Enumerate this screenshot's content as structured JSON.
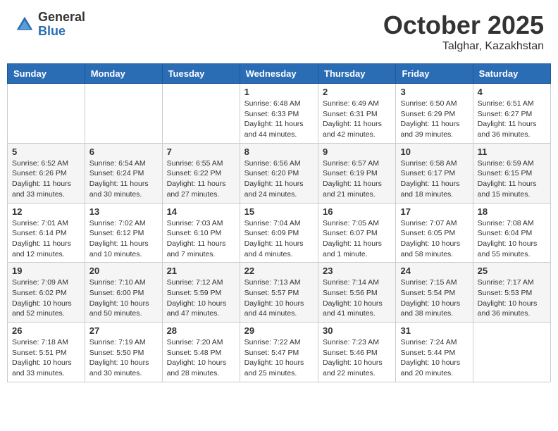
{
  "header": {
    "logo_general": "General",
    "logo_blue": "Blue",
    "month": "October 2025",
    "location": "Talghar, Kazakhstan"
  },
  "weekdays": [
    "Sunday",
    "Monday",
    "Tuesday",
    "Wednesday",
    "Thursday",
    "Friday",
    "Saturday"
  ],
  "weeks": [
    [
      {
        "day": null
      },
      {
        "day": null
      },
      {
        "day": null
      },
      {
        "day": "1",
        "sunrise": "6:48 AM",
        "sunset": "6:33 PM",
        "daylight": "11 hours and 44 minutes."
      },
      {
        "day": "2",
        "sunrise": "6:49 AM",
        "sunset": "6:31 PM",
        "daylight": "11 hours and 42 minutes."
      },
      {
        "day": "3",
        "sunrise": "6:50 AM",
        "sunset": "6:29 PM",
        "daylight": "11 hours and 39 minutes."
      },
      {
        "day": "4",
        "sunrise": "6:51 AM",
        "sunset": "6:27 PM",
        "daylight": "11 hours and 36 minutes."
      }
    ],
    [
      {
        "day": "5",
        "sunrise": "6:52 AM",
        "sunset": "6:26 PM",
        "daylight": "11 hours and 33 minutes."
      },
      {
        "day": "6",
        "sunrise": "6:54 AM",
        "sunset": "6:24 PM",
        "daylight": "11 hours and 30 minutes."
      },
      {
        "day": "7",
        "sunrise": "6:55 AM",
        "sunset": "6:22 PM",
        "daylight": "11 hours and 27 minutes."
      },
      {
        "day": "8",
        "sunrise": "6:56 AM",
        "sunset": "6:20 PM",
        "daylight": "11 hours and 24 minutes."
      },
      {
        "day": "9",
        "sunrise": "6:57 AM",
        "sunset": "6:19 PM",
        "daylight": "11 hours and 21 minutes."
      },
      {
        "day": "10",
        "sunrise": "6:58 AM",
        "sunset": "6:17 PM",
        "daylight": "11 hours and 18 minutes."
      },
      {
        "day": "11",
        "sunrise": "6:59 AM",
        "sunset": "6:15 PM",
        "daylight": "11 hours and 15 minutes."
      }
    ],
    [
      {
        "day": "12",
        "sunrise": "7:01 AM",
        "sunset": "6:14 PM",
        "daylight": "11 hours and 12 minutes."
      },
      {
        "day": "13",
        "sunrise": "7:02 AM",
        "sunset": "6:12 PM",
        "daylight": "11 hours and 10 minutes."
      },
      {
        "day": "14",
        "sunrise": "7:03 AM",
        "sunset": "6:10 PM",
        "daylight": "11 hours and 7 minutes."
      },
      {
        "day": "15",
        "sunrise": "7:04 AM",
        "sunset": "6:09 PM",
        "daylight": "11 hours and 4 minutes."
      },
      {
        "day": "16",
        "sunrise": "7:05 AM",
        "sunset": "6:07 PM",
        "daylight": "11 hours and 1 minute."
      },
      {
        "day": "17",
        "sunrise": "7:07 AM",
        "sunset": "6:05 PM",
        "daylight": "10 hours and 58 minutes."
      },
      {
        "day": "18",
        "sunrise": "7:08 AM",
        "sunset": "6:04 PM",
        "daylight": "10 hours and 55 minutes."
      }
    ],
    [
      {
        "day": "19",
        "sunrise": "7:09 AM",
        "sunset": "6:02 PM",
        "daylight": "10 hours and 52 minutes."
      },
      {
        "day": "20",
        "sunrise": "7:10 AM",
        "sunset": "6:00 PM",
        "daylight": "10 hours and 50 minutes."
      },
      {
        "day": "21",
        "sunrise": "7:12 AM",
        "sunset": "5:59 PM",
        "daylight": "10 hours and 47 minutes."
      },
      {
        "day": "22",
        "sunrise": "7:13 AM",
        "sunset": "5:57 PM",
        "daylight": "10 hours and 44 minutes."
      },
      {
        "day": "23",
        "sunrise": "7:14 AM",
        "sunset": "5:56 PM",
        "daylight": "10 hours and 41 minutes."
      },
      {
        "day": "24",
        "sunrise": "7:15 AM",
        "sunset": "5:54 PM",
        "daylight": "10 hours and 38 minutes."
      },
      {
        "day": "25",
        "sunrise": "7:17 AM",
        "sunset": "5:53 PM",
        "daylight": "10 hours and 36 minutes."
      }
    ],
    [
      {
        "day": "26",
        "sunrise": "7:18 AM",
        "sunset": "5:51 PM",
        "daylight": "10 hours and 33 minutes."
      },
      {
        "day": "27",
        "sunrise": "7:19 AM",
        "sunset": "5:50 PM",
        "daylight": "10 hours and 30 minutes."
      },
      {
        "day": "28",
        "sunrise": "7:20 AM",
        "sunset": "5:48 PM",
        "daylight": "10 hours and 28 minutes."
      },
      {
        "day": "29",
        "sunrise": "7:22 AM",
        "sunset": "5:47 PM",
        "daylight": "10 hours and 25 minutes."
      },
      {
        "day": "30",
        "sunrise": "7:23 AM",
        "sunset": "5:46 PM",
        "daylight": "10 hours and 22 minutes."
      },
      {
        "day": "31",
        "sunrise": "7:24 AM",
        "sunset": "5:44 PM",
        "daylight": "10 hours and 20 minutes."
      },
      {
        "day": null
      }
    ]
  ]
}
